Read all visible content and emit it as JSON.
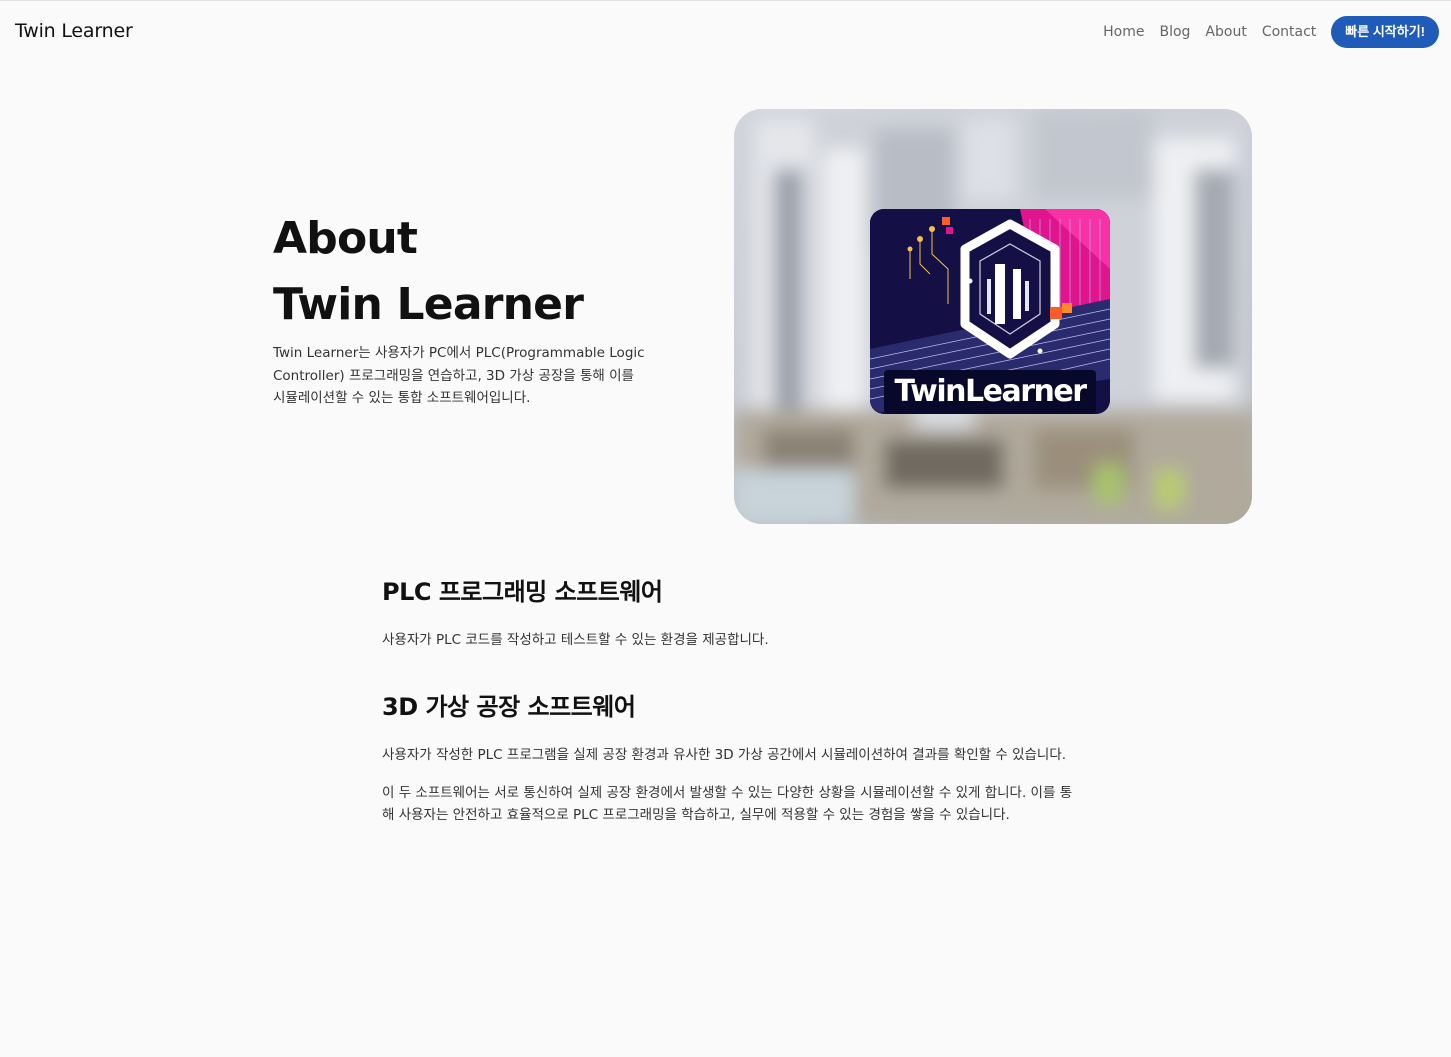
{
  "header": {
    "brand": "Twin Learner",
    "nav": [
      "Home",
      "Blog",
      "About",
      "Contact"
    ],
    "cta_label": "빠른 시작하기!"
  },
  "hero": {
    "title_line1": "About",
    "title_line2": "Twin Learner",
    "description": "Twin Learner는 사용자가 PC에서 PLC(Programmable Logic Controller) 프로그래밍을 연습하고, 3D 가상 공장을 통해 이를 시뮬레이션할 수 있는 통합 소프트웨어입니다.",
    "logo_text": "TwinLearner"
  },
  "sections": [
    {
      "heading": "PLC 프로그래밍 소프트웨어",
      "paragraphs": [
        "사용자가 PLC 코드를 작성하고 테스트할 수 있는 환경을 제공합니다."
      ]
    },
    {
      "heading": "3D 가상 공장 소프트웨어",
      "paragraphs": [
        "사용자가 작성한 PLC 프로그램을 실제 공장 환경과 유사한 3D 가상 공간에서 시뮬레이션하여 결과를 확인할 수 있습니다.",
        "이 두 소프트웨어는 서로 통신하여 실제 공장 환경에서 발생할 수 있는 다양한 상황을 시뮬레이션할 수 있게 합니다. 이를 통해 사용자는 안전하고 효율적으로 PLC 프로그래밍을 학습하고, 실무에 적용할 수 있는 경험을 쌓을 수 있습니다."
      ]
    }
  ],
  "colors": {
    "accent": "#1f5bb8",
    "background": "#fafafa",
    "logo_bg": "#141046",
    "logo_magenta": "#e0148c"
  }
}
